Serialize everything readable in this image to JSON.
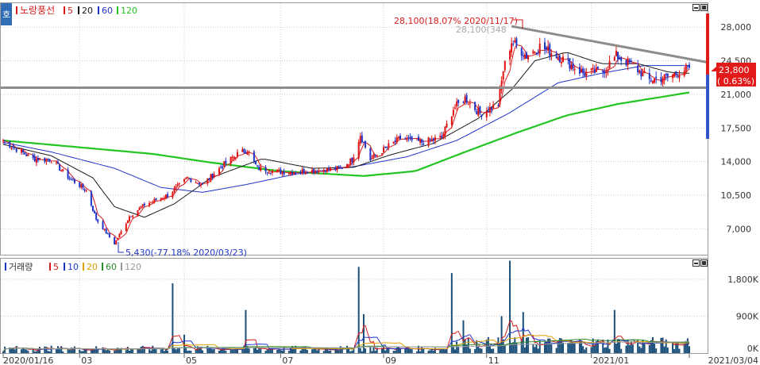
{
  "top_legend": {
    "badge": "호",
    "title": "노랑풍선",
    "items": [
      {
        "label": "5",
        "color": "#d81b1b"
      },
      {
        "label": "20",
        "color": "#1a1a1a"
      },
      {
        "label": "60",
        "color": "#1f35c9"
      },
      {
        "label": "120",
        "color": "#22c522"
      }
    ]
  },
  "volume_legend": {
    "title": "거래량",
    "items": [
      {
        "label": "5",
        "color": "#d81b1b"
      },
      {
        "label": "10",
        "color": "#1f35c9"
      },
      {
        "label": "20",
        "color": "#e0a000"
      },
      {
        "label": "60",
        "color": "#2a8a2a"
      },
      {
        "label": "120",
        "color": "#999999"
      }
    ]
  },
  "annotations": {
    "high": "28,100(18.07% 2020/11/17)",
    "high_marker": "28,100(348",
    "low": "5,430(-77.18% 2020/03/23)"
  },
  "price_tags": {
    "current": "23,800",
    "change": "( 0.63%)"
  },
  "x_labels": [
    "2020/01/16",
    "03",
    "05",
    "07",
    "09",
    "11",
    "2021/01",
    "2021/03/04"
  ],
  "chart_data": [
    {
      "type": "candlestick",
      "title": "노랑풍선",
      "y_ticks": [
        7000,
        10500,
        14000,
        17500,
        21000,
        24500,
        28000
      ],
      "y_tick_labels": [
        "7,000",
        "10,500",
        "14,000",
        "17,500",
        "21,000",
        "24,500",
        "28,000"
      ],
      "ylim": [
        4300,
        30500
      ],
      "x_range": [
        "2020-01-16",
        "2021-03-04"
      ],
      "horizontal_line": 21700,
      "trendline": {
        "from": {
          "date": "2020-11-17",
          "value": 28100
        },
        "to": {
          "date": "2021-03-04",
          "value": 24100
        }
      },
      "close_keyframes": [
        {
          "date": "2020-01-16",
          "value": 16200
        },
        {
          "date": "2020-01-22",
          "value": 15500
        },
        {
          "date": "2020-02-03",
          "value": 14300
        },
        {
          "date": "2020-02-14",
          "value": 14200
        },
        {
          "date": "2020-02-24",
          "value": 12400
        },
        {
          "date": "2020-03-06",
          "value": 11000
        },
        {
          "date": "2020-03-12",
          "value": 8000
        },
        {
          "date": "2020-03-23",
          "value": 5430
        },
        {
          "date": "2020-04-01",
          "value": 8300
        },
        {
          "date": "2020-04-10",
          "value": 9500
        },
        {
          "date": "2020-04-24",
          "value": 10500
        },
        {
          "date": "2020-05-06",
          "value": 12300
        },
        {
          "date": "2020-05-15",
          "value": 11600
        },
        {
          "date": "2020-05-27",
          "value": 13600
        },
        {
          "date": "2020-06-05",
          "value": 14800
        },
        {
          "date": "2020-06-11",
          "value": 15200
        },
        {
          "date": "2020-06-17",
          "value": 13300
        },
        {
          "date": "2020-07-01",
          "value": 12900
        },
        {
          "date": "2020-07-14",
          "value": 13000
        },
        {
          "date": "2020-07-24",
          "value": 13100
        },
        {
          "date": "2020-08-06",
          "value": 13300
        },
        {
          "date": "2020-08-13",
          "value": 14200
        },
        {
          "date": "2020-08-18",
          "value": 16800
        },
        {
          "date": "2020-08-24",
          "value": 14200
        },
        {
          "date": "2020-09-03",
          "value": 15500
        },
        {
          "date": "2020-09-11",
          "value": 16400
        },
        {
          "date": "2020-09-24",
          "value": 16000
        },
        {
          "date": "2020-10-06",
          "value": 16500
        },
        {
          "date": "2020-10-13",
          "value": 19500
        },
        {
          "date": "2020-10-20",
          "value": 20600
        },
        {
          "date": "2020-10-29",
          "value": 19000
        },
        {
          "date": "2020-11-09",
          "value": 20000
        },
        {
          "date": "2020-11-12",
          "value": 23500
        },
        {
          "date": "2020-11-17",
          "value": 26500
        },
        {
          "date": "2020-11-26",
          "value": 25000
        },
        {
          "date": "2020-12-04",
          "value": 26000
        },
        {
          "date": "2020-12-17",
          "value": 24800
        },
        {
          "date": "2020-12-30",
          "value": 23200
        },
        {
          "date": "2021-01-11",
          "value": 23400
        },
        {
          "date": "2021-01-19",
          "value": 25000
        },
        {
          "date": "2021-01-29",
          "value": 24000
        },
        {
          "date": "2021-02-08",
          "value": 22500
        },
        {
          "date": "2021-02-19",
          "value": 22800
        },
        {
          "date": "2021-03-04",
          "value": 23800
        }
      ],
      "ma_keyframes": {
        "ma20": [
          {
            "date": "2020-01-16",
            "value": 15800
          },
          {
            "date": "2020-02-14",
            "value": 14600
          },
          {
            "date": "2020-03-10",
            "value": 12300
          },
          {
            "date": "2020-03-23",
            "value": 9300
          },
          {
            "date": "2020-04-10",
            "value": 8200
          },
          {
            "date": "2020-04-28",
            "value": 9600
          },
          {
            "date": "2020-05-20",
            "value": 12300
          },
          {
            "date": "2020-06-20",
            "value": 14300
          },
          {
            "date": "2020-07-20",
            "value": 13300
          },
          {
            "date": "2020-08-14",
            "value": 13400
          },
          {
            "date": "2020-09-05",
            "value": 14700
          },
          {
            "date": "2020-10-01",
            "value": 15900
          },
          {
            "date": "2020-10-28",
            "value": 18500
          },
          {
            "date": "2020-11-17",
            "value": 21500
          },
          {
            "date": "2020-12-01",
            "value": 24500
          },
          {
            "date": "2020-12-20",
            "value": 25400
          },
          {
            "date": "2021-01-10",
            "value": 24200
          },
          {
            "date": "2021-02-01",
            "value": 24200
          },
          {
            "date": "2021-02-20",
            "value": 23300
          },
          {
            "date": "2021-03-04",
            "value": 23200
          }
        ],
        "ma60": [
          {
            "date": "2020-01-16",
            "value": 16000
          },
          {
            "date": "2020-02-14",
            "value": 15000
          },
          {
            "date": "2020-03-23",
            "value": 13300
          },
          {
            "date": "2020-04-20",
            "value": 11300
          },
          {
            "date": "2020-05-15",
            "value": 10800
          },
          {
            "date": "2020-06-10",
            "value": 11600
          },
          {
            "date": "2020-07-10",
            "value": 12700
          },
          {
            "date": "2020-08-15",
            "value": 13500
          },
          {
            "date": "2020-09-15",
            "value": 14500
          },
          {
            "date": "2020-10-15",
            "value": 16200
          },
          {
            "date": "2020-11-15",
            "value": 19000
          },
          {
            "date": "2020-12-15",
            "value": 22200
          },
          {
            "date": "2021-01-10",
            "value": 23200
          },
          {
            "date": "2021-02-05",
            "value": 24000
          },
          {
            "date": "2021-03-04",
            "value": 24000
          }
        ],
        "ma120": [
          {
            "date": "2020-01-16",
            "value": 16200
          },
          {
            "date": "2020-03-01",
            "value": 15500
          },
          {
            "date": "2020-04-15",
            "value": 14800
          },
          {
            "date": "2020-05-20",
            "value": 13900
          },
          {
            "date": "2020-07-01",
            "value": 13000
          },
          {
            "date": "2020-08-20",
            "value": 12500
          },
          {
            "date": "2020-09-20",
            "value": 13000
          },
          {
            "date": "2020-10-20",
            "value": 15000
          },
          {
            "date": "2020-11-20",
            "value": 17000
          },
          {
            "date": "2020-12-20",
            "value": 18800
          },
          {
            "date": "2021-01-20",
            "value": 20000
          },
          {
            "date": "2021-03-04",
            "value": 21200
          }
        ]
      }
    },
    {
      "type": "bar",
      "title": "거래량",
      "y_ticks": [
        0,
        900000,
        1800000
      ],
      "y_tick_labels": [
        "0K",
        "900K",
        "1,800K"
      ],
      "ylim": [
        0,
        2300000
      ],
      "baseline": 100000,
      "spikes": [
        {
          "date": "2020-04-28",
          "value": 1700000
        },
        {
          "date": "2020-05-04",
          "value": 450000
        },
        {
          "date": "2020-06-11",
          "value": 1050000
        },
        {
          "date": "2020-08-18",
          "value": 2100000
        },
        {
          "date": "2020-08-21",
          "value": 950000
        },
        {
          "date": "2020-10-13",
          "value": 1950000
        },
        {
          "date": "2020-10-20",
          "value": 800000
        },
        {
          "date": "2020-11-12",
          "value": 900000
        },
        {
          "date": "2020-11-17",
          "value": 2250000
        },
        {
          "date": "2020-11-25",
          "value": 1000000
        },
        {
          "date": "2021-01-19",
          "value": 1050000
        },
        {
          "date": "2021-03-04",
          "value": 360000
        }
      ]
    }
  ]
}
